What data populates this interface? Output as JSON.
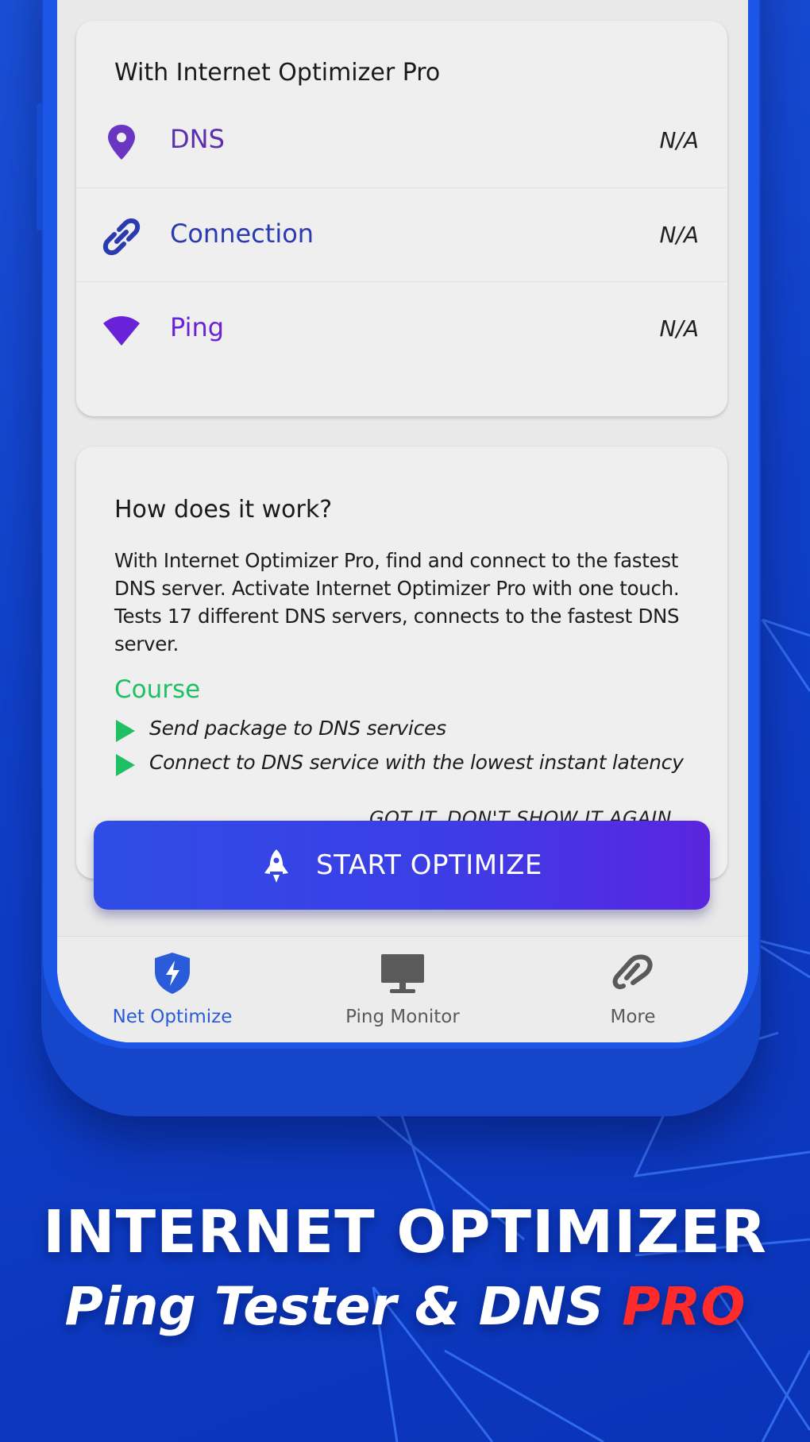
{
  "card_stats": {
    "title": "With Internet Optimizer Pro",
    "rows": [
      {
        "label": "DNS",
        "value": "N/A",
        "icon": "location-pin-icon",
        "color": "#5b2fb0"
      },
      {
        "label": "Connection",
        "value": "N/A",
        "icon": "link-icon",
        "color": "#2a3bb0"
      },
      {
        "label": "Ping",
        "value": "N/A",
        "icon": "wifi-icon",
        "color": "#6a22d8"
      }
    ]
  },
  "card_how": {
    "title": "How does it work?",
    "description": "With Internet Optimizer Pro, find and connect to the fastest DNS server. Activate Internet Optimizer Pro with one touch. Tests 17 different DNS servers, connects to the fastest DNS server.",
    "course_title": "Course",
    "steps": [
      "Send package to DNS services",
      "Connect to DNS service with the lowest instant latency"
    ],
    "dismiss_label": "GOT IT, DON'T SHOW IT AGAIN"
  },
  "start_button": {
    "label": "START OPTIMIZE",
    "icon": "rocket-icon"
  },
  "tabs": [
    {
      "label": "Net Optimize",
      "icon": "shield-bolt-icon",
      "active": true
    },
    {
      "label": "Ping Monitor",
      "icon": "monitor-icon",
      "active": false
    },
    {
      "label": "More",
      "icon": "link-chain-icon",
      "active": false
    }
  ],
  "promo": {
    "headline": "INTERNET OPTIMIZER",
    "subline_main": "Ping Tester & DNS",
    "subline_accent": "PRO"
  },
  "colors": {
    "background": "#0f3fc9",
    "accent_green": "#1fc063",
    "active_tab": "#2a5bd8",
    "pro_red": "#ff2a2a"
  }
}
